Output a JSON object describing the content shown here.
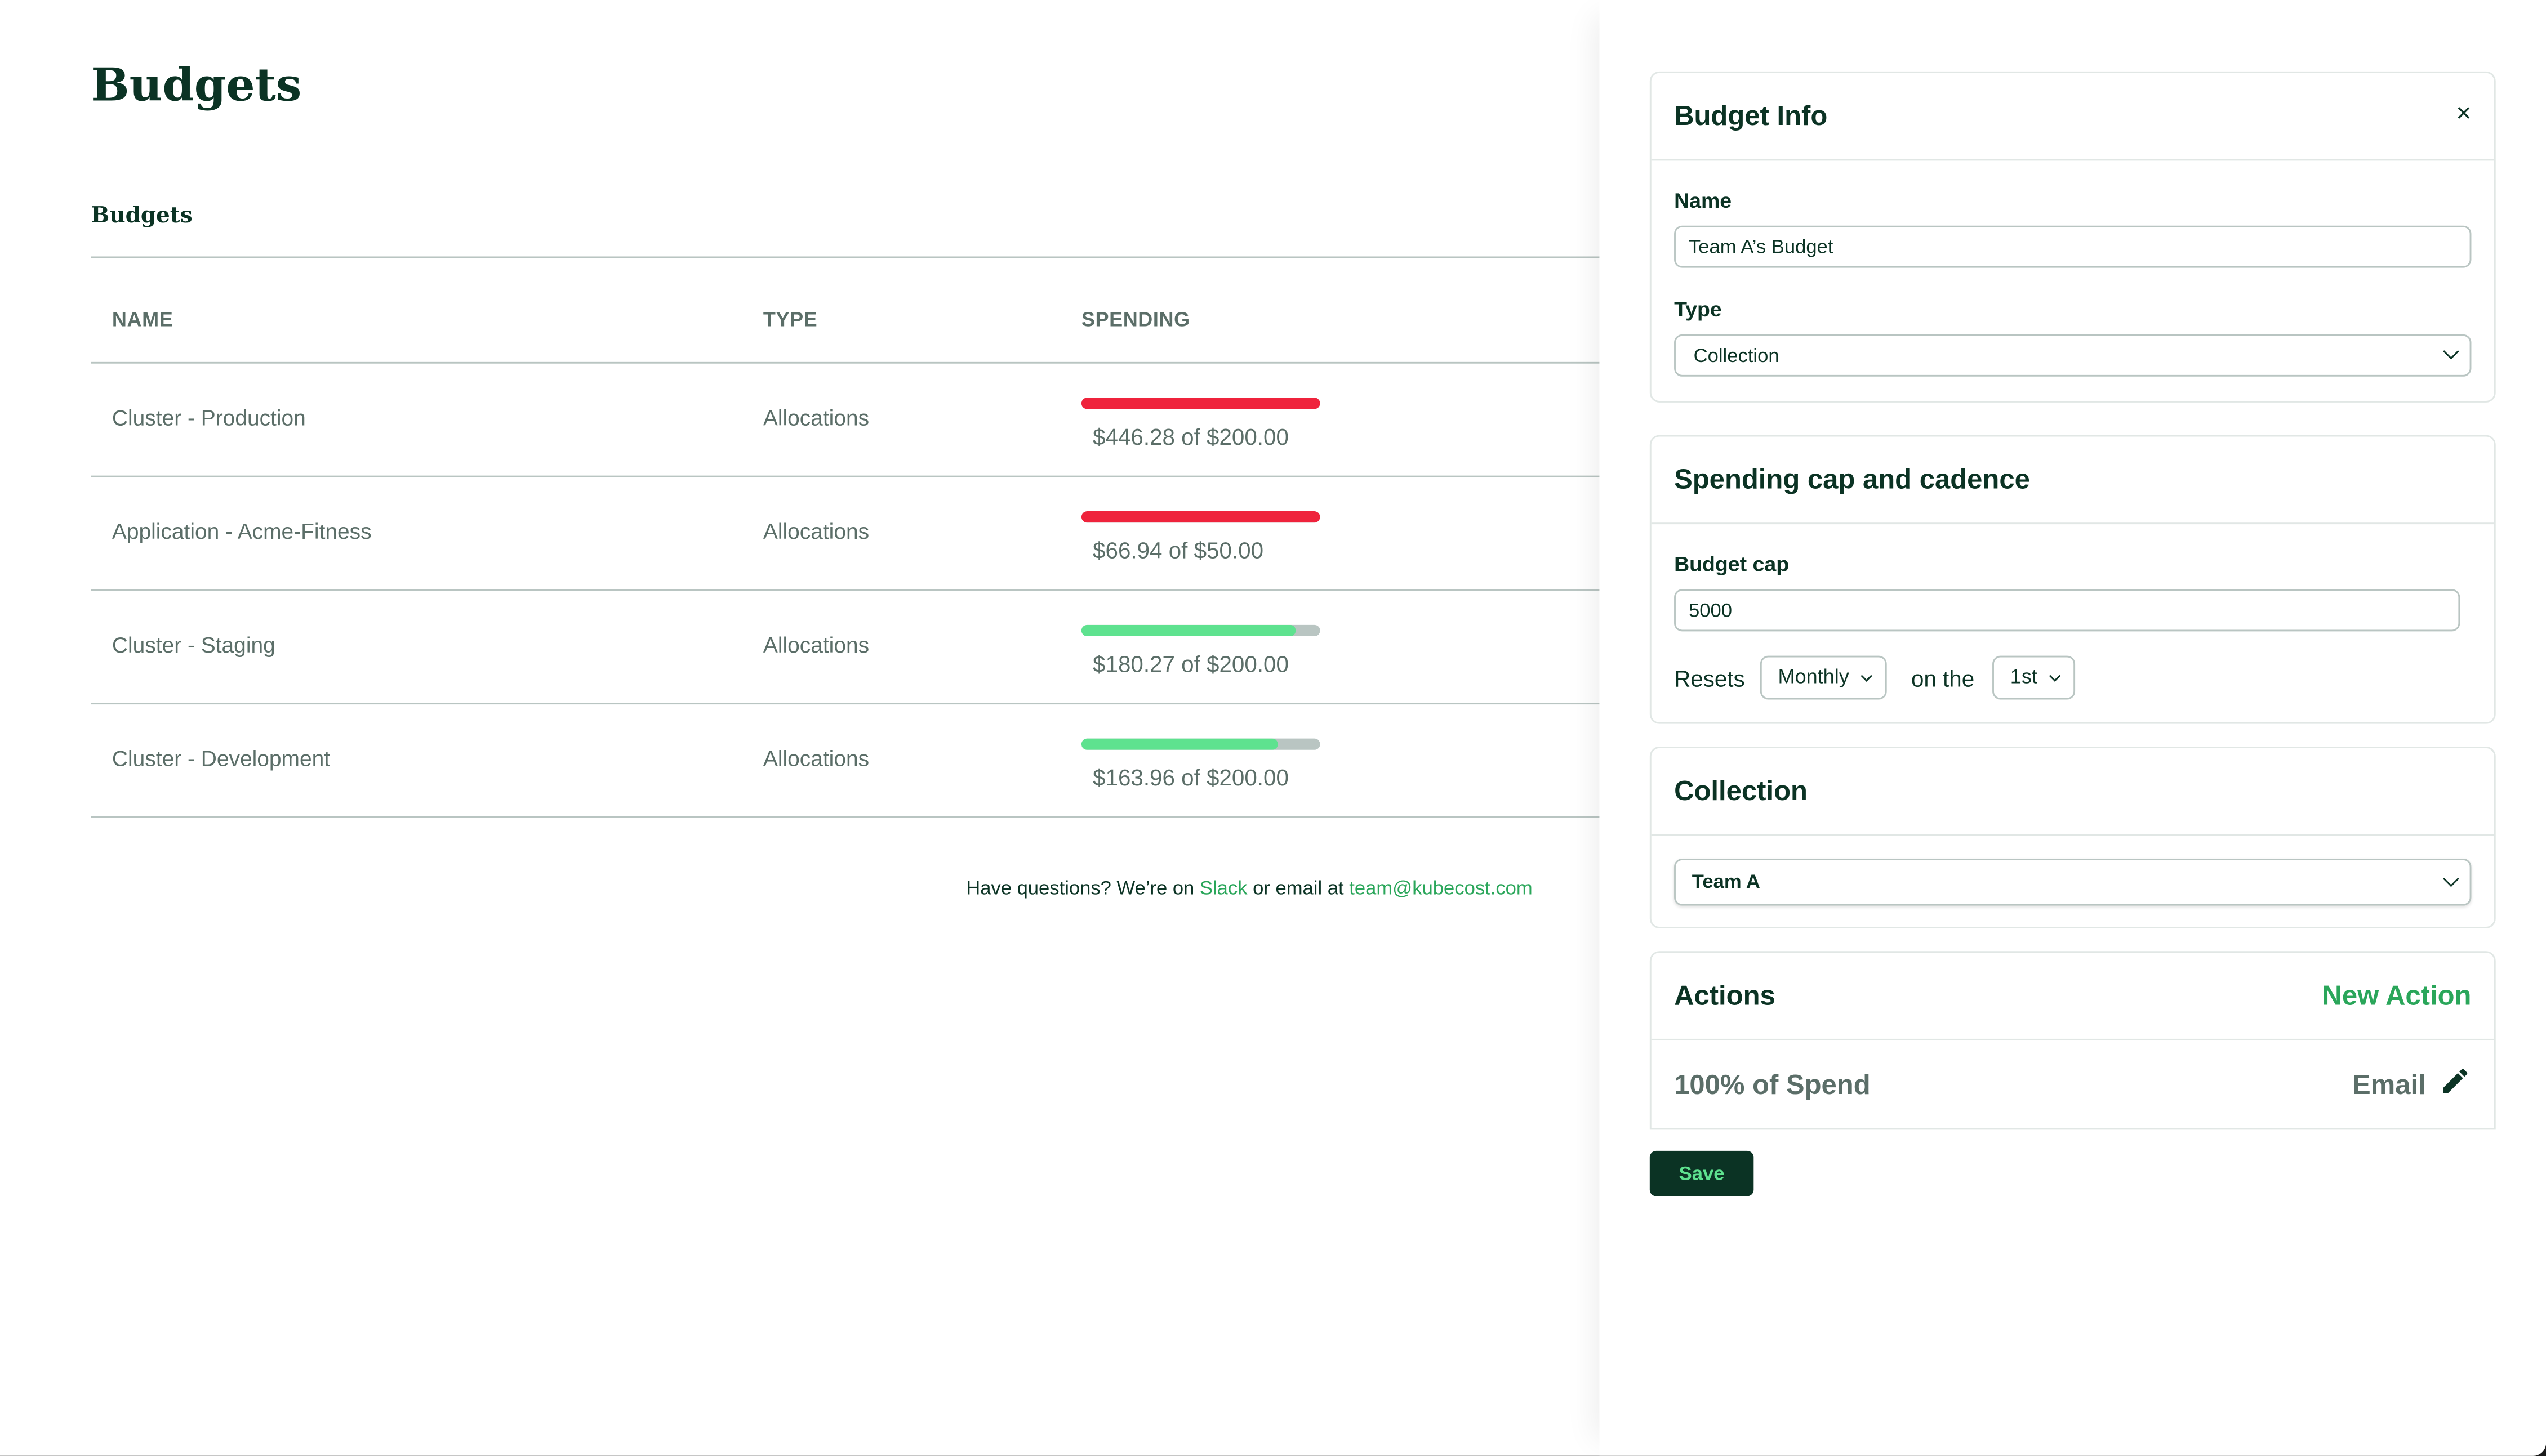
{
  "page": {
    "title": "Budgets",
    "section_title": "Budgets"
  },
  "table": {
    "columns": [
      "NAME",
      "TYPE",
      "SPENDING"
    ],
    "rows": [
      {
        "name": "Cluster - Production",
        "type": "Allocations",
        "spend": "$446.28",
        "cap": "$200.00",
        "spend_text": "$446.28 of $200.00",
        "progress": 1.0,
        "status": "over"
      },
      {
        "name": "Application - Acme-Fitness",
        "type": "Allocations",
        "spend": "$66.94",
        "cap": "$50.00",
        "spend_text": "$66.94 of $50.00",
        "progress": 1.0,
        "status": "over"
      },
      {
        "name": "Cluster - Staging",
        "type": "Allocations",
        "spend": "$180.27",
        "cap": "$200.00",
        "spend_text": "$180.27 of $200.00",
        "progress": 0.9,
        "status": "ok"
      },
      {
        "name": "Cluster - Development",
        "type": "Allocations",
        "spend": "$163.96",
        "cap": "$200.00",
        "spend_text": "$163.96 of $200.00",
        "progress": 0.82,
        "status": "ok"
      }
    ]
  },
  "footer": {
    "prefix": "Have questions? We’re on ",
    "slack_link": "Slack",
    "middle": " or email at ",
    "email_link": "team@kubecost.com"
  },
  "colors": {
    "over": "#ef233c",
    "ok": "#5ee28f",
    "track": "#b9c5c2",
    "accent": "#2aa65a",
    "primary": "#0b3324"
  },
  "panel": {
    "budget_info": {
      "title": "Budget Info",
      "close_icon": "×",
      "name_label": "Name",
      "name_value": "Team A’s Budget",
      "type_label": "Type",
      "type_value": "Collection"
    },
    "spending": {
      "title": "Spending cap and cadence",
      "cap_label": "Budget cap",
      "cap_value": "5000",
      "resets_label": "Resets",
      "cadence_value": "Monthly",
      "on_the_label": "on the",
      "day_value": "1st"
    },
    "collection": {
      "title": "Collection",
      "value": "Team A"
    },
    "actions": {
      "title": "Actions",
      "new_action_label": "New Action",
      "items": [
        {
          "label": "100% of Spend",
          "type": "Email",
          "icon": "pencil-icon"
        }
      ]
    },
    "save_label": "Save"
  }
}
